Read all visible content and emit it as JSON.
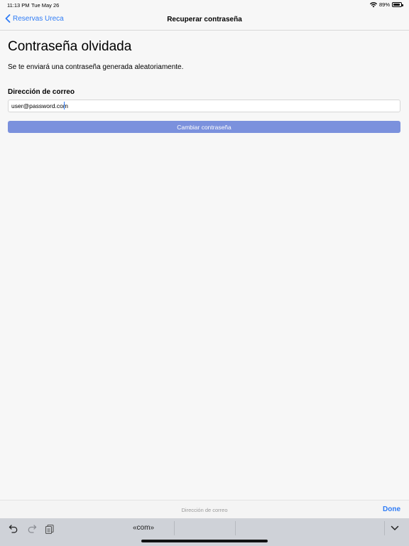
{
  "status_bar": {
    "time": "11:13 PM",
    "date": "Tue May 26",
    "battery_text": "89%",
    "battery_level": 0.89
  },
  "nav": {
    "back_label": "Reservas Ureca",
    "title": "Recuperar contraseña"
  },
  "main": {
    "title": "Contraseña olvidada",
    "subtitle": "Se te enviará una contraseña generada aleatoriamente.",
    "email_label": "Dirección de correo",
    "email_value": "user@password.com",
    "submit_label": "Cambiar contraseña"
  },
  "accessory": {
    "hint": "Dirección de correo",
    "done_label": "Done"
  },
  "shortcut_bar": {
    "suggestion_1": "«com»",
    "icons": [
      "undo-icon",
      "redo-icon",
      "paste-icon",
      "chevron-down-icon"
    ]
  },
  "colors": {
    "accent": "#2f7cf6",
    "button_bg": "#7b91dd",
    "background": "#f7f7f7",
    "keyboard_bg": "#cfd2d8"
  }
}
